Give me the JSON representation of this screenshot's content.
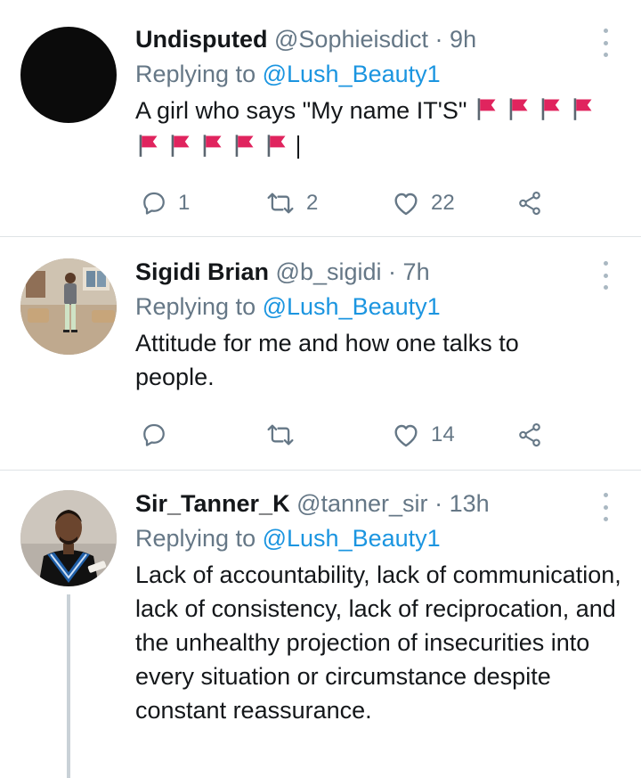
{
  "tweets": [
    {
      "name": "Undisputed",
      "handle": "@Sophieisdict",
      "time": "9h",
      "replying_label": "Replying to",
      "reply_to": "@Lush_Beauty1",
      "text": "A girl who says \"My name IT'S\"",
      "flag_count": 9,
      "replies": "1",
      "retweets": "2",
      "likes": "22"
    },
    {
      "name": "Sigidi Brian",
      "handle": "@b_sigidi",
      "time": "7h",
      "replying_label": "Replying to",
      "reply_to": "@Lush_Beauty1",
      "text": "Attitude for me and how one talks to people.",
      "replies": "",
      "retweets": "",
      "likes": "14"
    },
    {
      "name": "Sir_Tanner_K",
      "handle": "@tanner_sir",
      "time": "13h",
      "replying_label": "Replying to",
      "reply_to": "@Lush_Beauty1",
      "text": "Lack of accountability, lack of communication, lack of consistency, lack of reciprocation, and the unhealthy projection of insecurities into every situation or circumstance despite constant reassurance."
    }
  ],
  "colors": {
    "text": "#14171a",
    "muted": "#657786",
    "link": "#1b95e0",
    "flag": "#e0245e",
    "divider": "#dfe3e6"
  },
  "icons": [
    "more-vertical-icon",
    "reply-icon",
    "retweet-icon",
    "like-icon",
    "share-icon",
    "red-flag-icon"
  ]
}
